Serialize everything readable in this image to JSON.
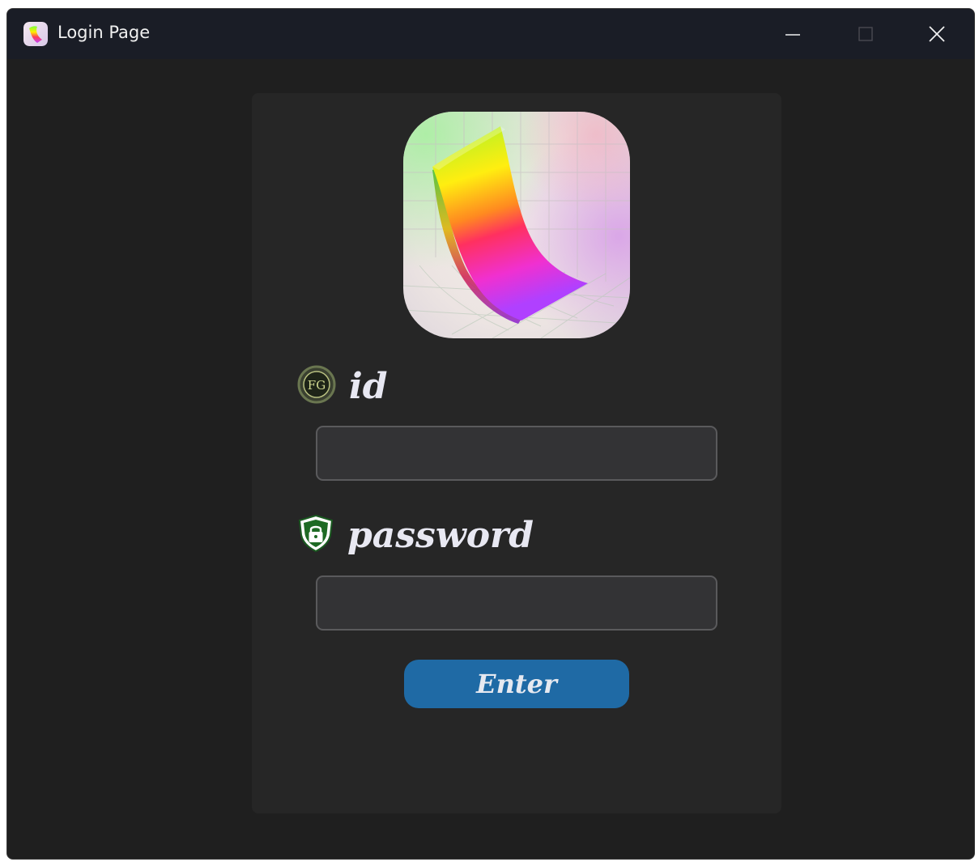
{
  "window": {
    "title": "Login Page",
    "controls": [
      "minimize",
      "maximize",
      "close"
    ]
  },
  "logo": {
    "icon": "ribbon-surface-logo"
  },
  "id_field": {
    "label": "id",
    "icon": "fg-badge-icon",
    "value": "",
    "placeholder": ""
  },
  "password_field": {
    "label": "password",
    "icon": "lock-shield-icon",
    "value": "",
    "placeholder": ""
  },
  "enter_button": {
    "label": "Enter"
  },
  "colors": {
    "titlebar": "#1a1d26",
    "background": "#1f1f1f",
    "panel": "#262626",
    "input_bg": "#333335",
    "input_border": "#5a5a5c",
    "button": "#1f6aa5",
    "label_text": "#e8e8f2"
  }
}
